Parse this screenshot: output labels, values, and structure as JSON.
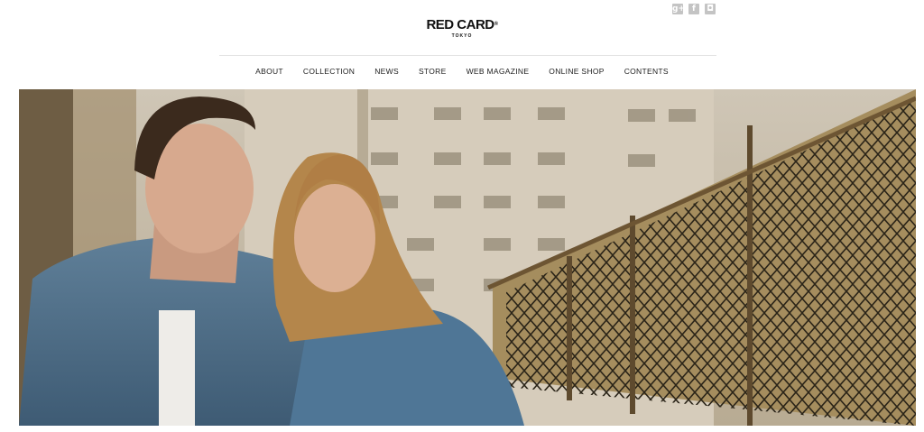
{
  "social": [
    {
      "name": "google-plus-icon",
      "glyph": "g+"
    },
    {
      "name": "facebook-icon",
      "glyph": "f"
    },
    {
      "name": "instagram-icon",
      "glyph": "◘"
    }
  ],
  "logo": {
    "brand": "RED CARD",
    "mark": "®",
    "sub": "TOKYO"
  },
  "nav": [
    "ABOUT",
    "COLLECTION",
    "NEWS",
    "STORE",
    "WEB MAGAZINE",
    "ONLINE SHOP",
    "CONTENTS"
  ],
  "hero": {
    "alt_subject": "two models in denim jackets beside a chain-link fence"
  }
}
